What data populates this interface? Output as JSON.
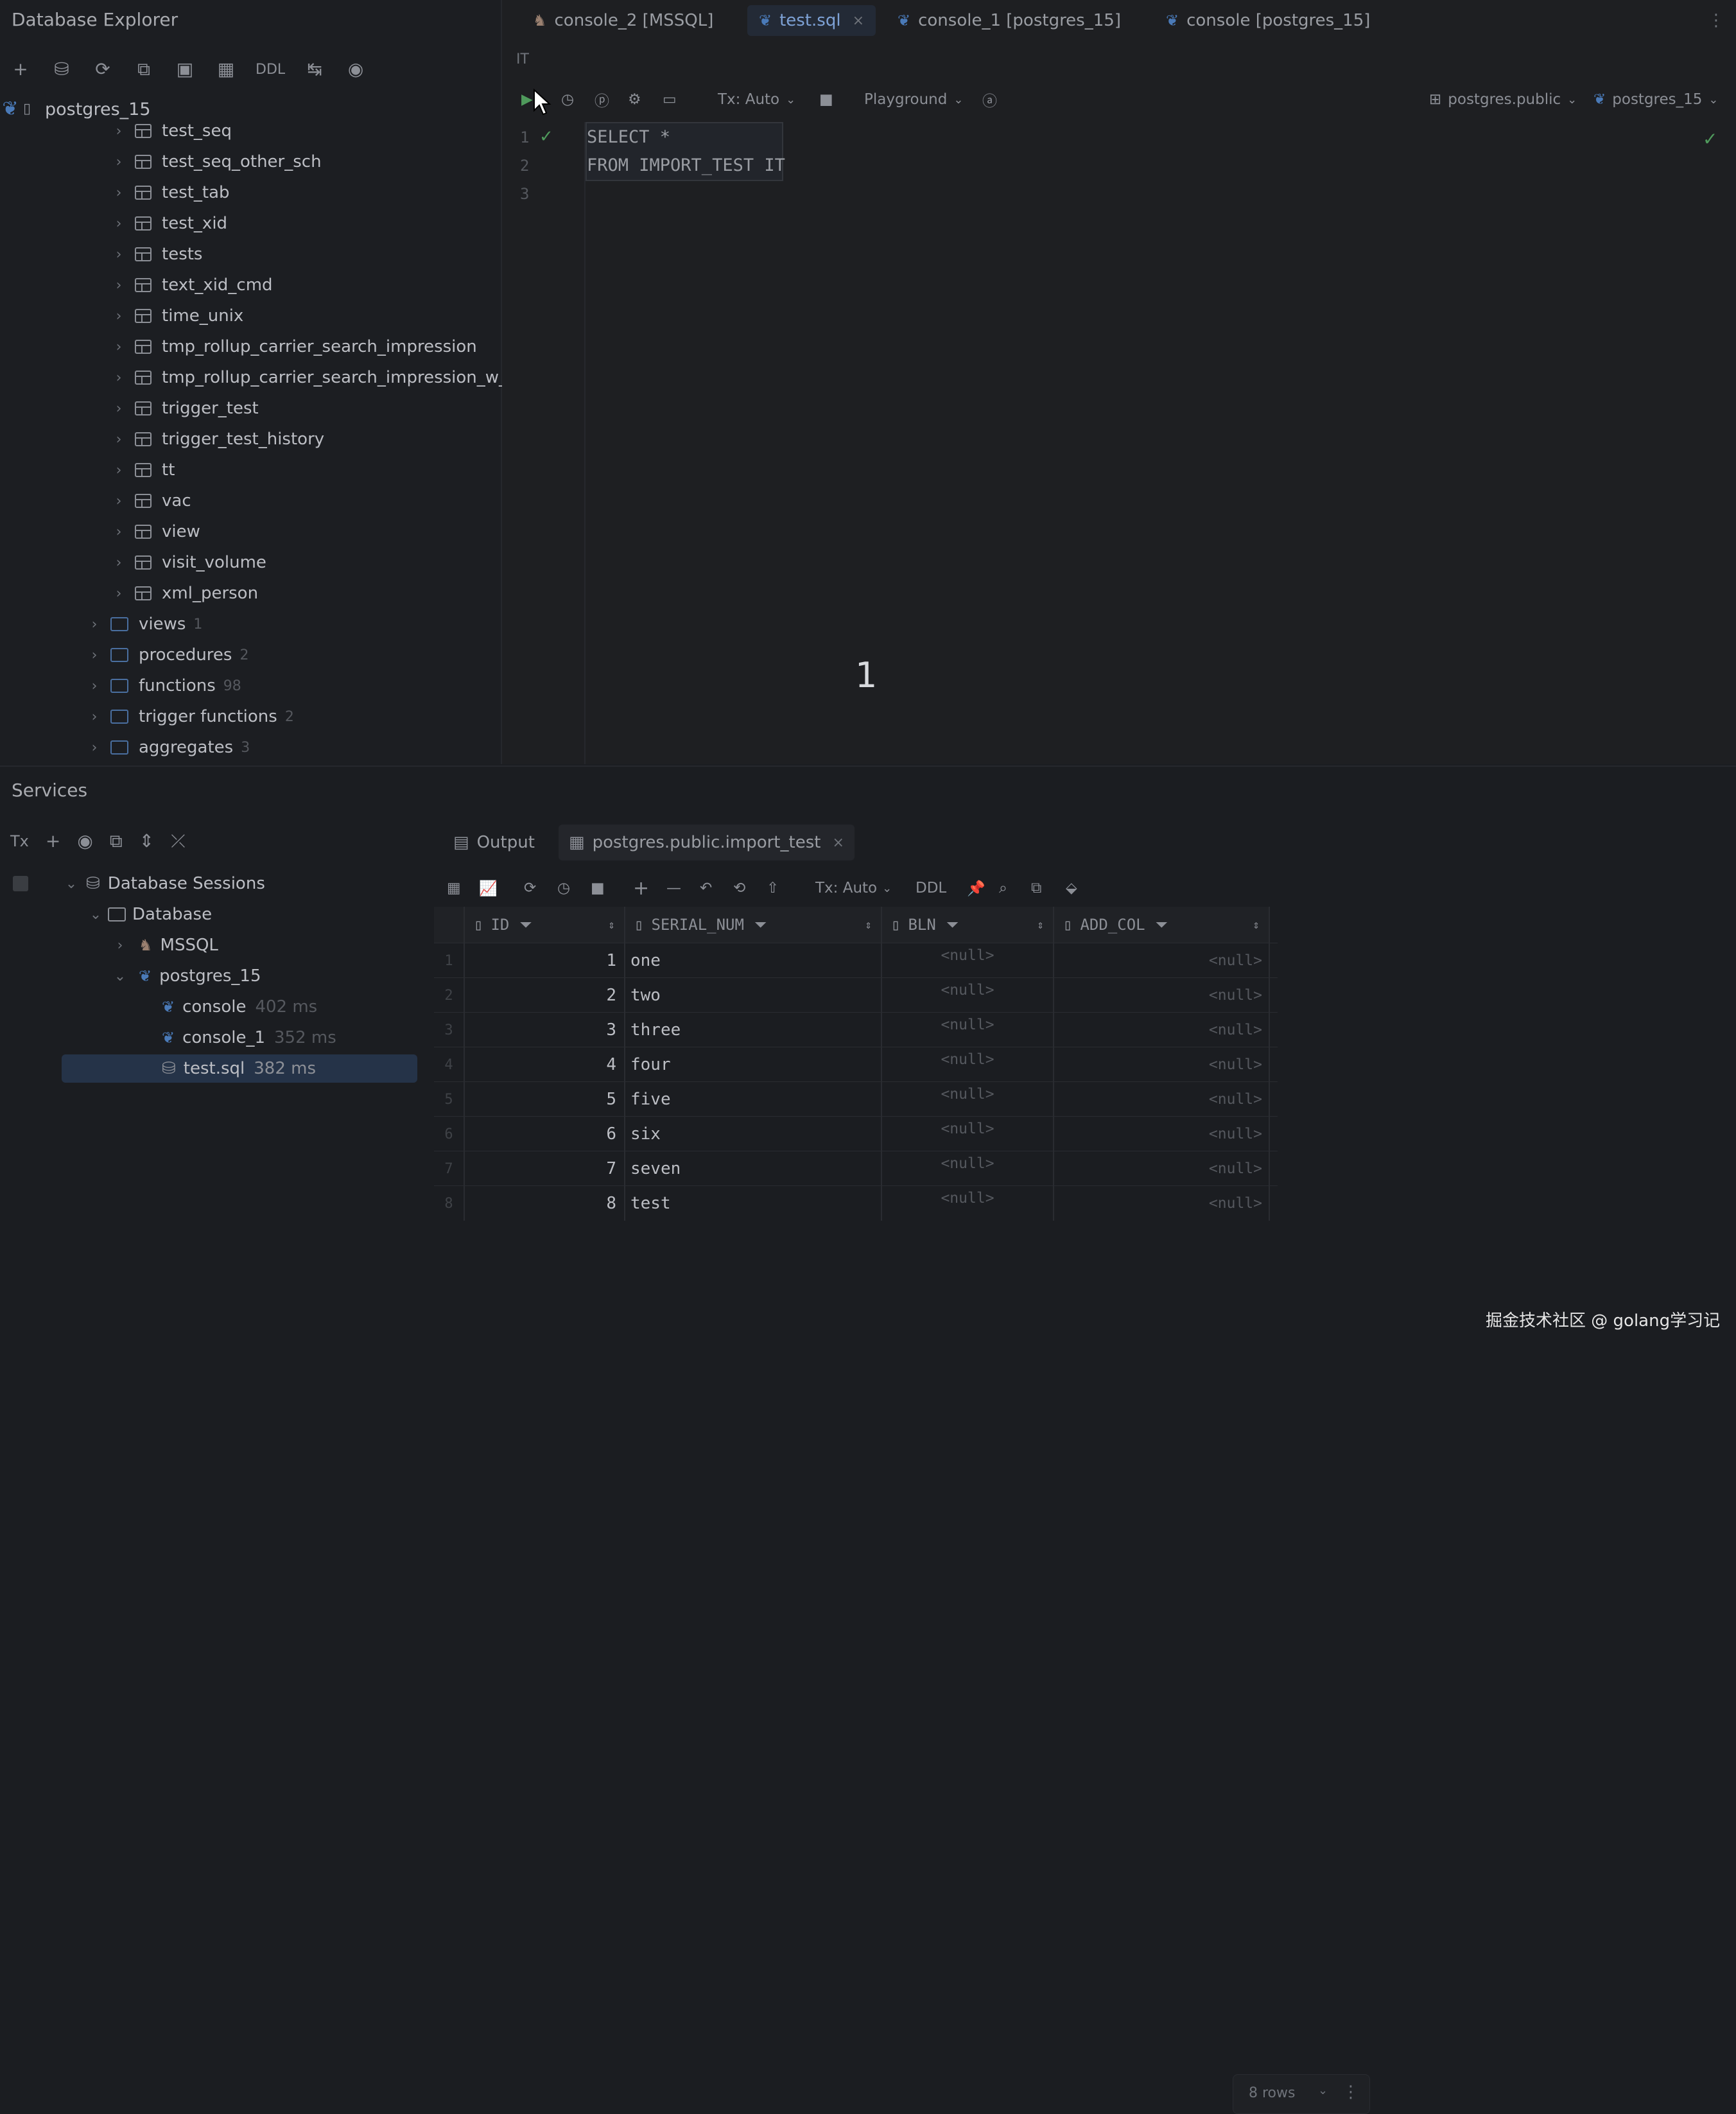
{
  "explorer": {
    "title": "Database Explorer",
    "toolbar": {
      "ddl": "DDL"
    },
    "root": "postgres_15",
    "tables": [
      "test_seq",
      "test_seq_other_sch",
      "test_tab",
      "test_xid",
      "tests",
      "text_xid_cmd",
      "time_unix",
      "tmp_rollup_carrier_search_impression",
      "tmp_rollup_carrier_search_impression_w_a",
      "trigger_test",
      "trigger_test_history",
      "tt",
      "vac",
      "view",
      "visit_volume",
      "xml_person"
    ],
    "folders": [
      {
        "label": "views",
        "count": "1"
      },
      {
        "label": "procedures",
        "count": "2"
      },
      {
        "label": "functions",
        "count": "98"
      },
      {
        "label": "trigger functions",
        "count": "2"
      },
      {
        "label": "aggregates",
        "count": "3"
      }
    ]
  },
  "editor": {
    "tabs": [
      {
        "label": "console_2 [MSSQL]",
        "kind": "mssql"
      },
      {
        "label": "test.sql",
        "kind": "pg",
        "active": true,
        "close": "×"
      },
      {
        "label": "console_1 [postgres_15]",
        "kind": "pg"
      },
      {
        "label": "console [postgres_15]",
        "kind": "pg"
      }
    ],
    "more": "⋮",
    "breadcrumb": "IT",
    "toolbar": {
      "tx": "Tx: Auto",
      "playground": "Playground",
      "schema": "postgres.public",
      "datasource": "postgres_15"
    },
    "lines": [
      {
        "num": "1",
        "code": "SELECT *"
      },
      {
        "num": "2",
        "code": "FROM IMPORT_TEST IT"
      },
      {
        "num": "3",
        "code": ""
      }
    ],
    "overlay_number": "1"
  },
  "services": {
    "title": "Services",
    "toolbar": {
      "tx": "Tx"
    },
    "sessions": {
      "root": "Database Sessions",
      "database": "Database",
      "mssql": "MSSQL",
      "postgres": "postgres_15",
      "consoles": [
        {
          "label": "console",
          "time": "402 ms"
        },
        {
          "label": "console_1",
          "time": "352 ms"
        },
        {
          "label": "test.sql",
          "time": "382 ms"
        }
      ]
    },
    "result_tabs": {
      "output": "Output",
      "table": "postgres.public.import_test",
      "close": "×"
    },
    "result_toolbar": {
      "tx": "Tx: Auto",
      "ddl": "DDL"
    },
    "columns": [
      "ID",
      "SERIAL_NUM",
      "BLN",
      "ADD_COL"
    ],
    "rows": [
      {
        "n": "1",
        "id": "1",
        "serial": "one",
        "bln": "<null>",
        "add": "<null>"
      },
      {
        "n": "2",
        "id": "2",
        "serial": "two",
        "bln": "<null>",
        "add": "<null>"
      },
      {
        "n": "3",
        "id": "3",
        "serial": "three",
        "bln": "<null>",
        "add": "<null>"
      },
      {
        "n": "4",
        "id": "4",
        "serial": "four",
        "bln": "<null>",
        "add": "<null>"
      },
      {
        "n": "5",
        "id": "5",
        "serial": "five",
        "bln": "<null>",
        "add": "<null>"
      },
      {
        "n": "6",
        "id": "6",
        "serial": "six",
        "bln": "<null>",
        "add": "<null>"
      },
      {
        "n": "7",
        "id": "7",
        "serial": "seven",
        "bln": "<null>",
        "add": "<null>"
      },
      {
        "n": "8",
        "id": "8",
        "serial": "test",
        "bln": "<null>",
        "add": "<null>"
      }
    ],
    "rows_count": "8 rows",
    "more": "⋮"
  },
  "watermark": "掘金技术社区 @ golang学习记",
  "colors": {
    "background": "#1b1d21",
    "accent": "#7ea2d6",
    "selection": "#253348"
  }
}
